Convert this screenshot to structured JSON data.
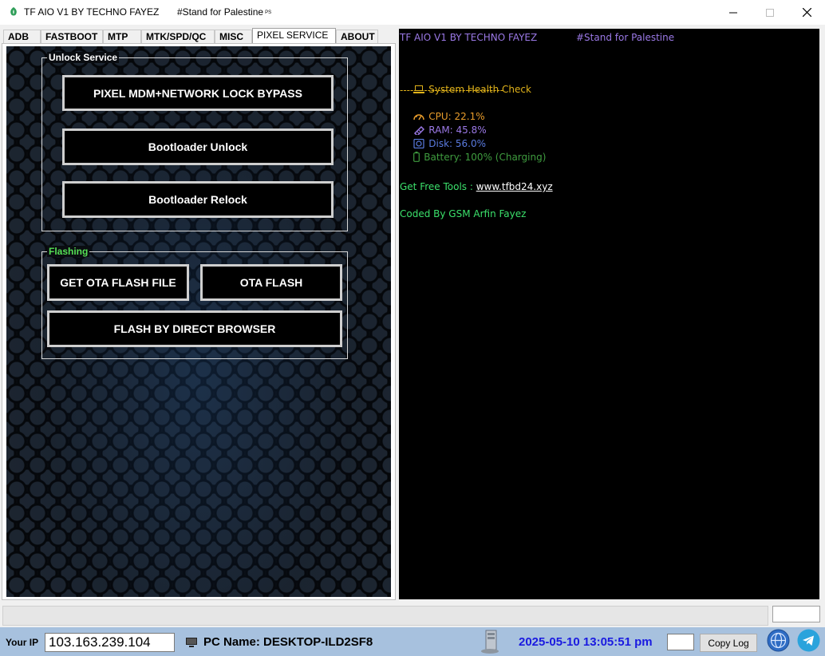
{
  "window": {
    "title": "TF AIO V1 BY TECHNO FAYEZ",
    "subtitle": "#Stand for Palestine",
    "subtitle_suffix": "PS"
  },
  "tabs": [
    {
      "label": "ADB"
    },
    {
      "label": "FASTBOOT"
    },
    {
      "label": "MTP"
    },
    {
      "label": "MTK/SPD/QC"
    },
    {
      "label": "MISC"
    },
    {
      "label": "PIXEL SERVICE",
      "active": true
    },
    {
      "label": "ABOUT"
    }
  ],
  "unlock_service": {
    "legend": "Unlock Service",
    "buttons": {
      "mdm": "PIXEL MDM+NETWORK LOCK BYPASS",
      "bl_unlock": "Bootloader Unlock",
      "bl_relock": "Bootloader Relock"
    }
  },
  "flashing": {
    "legend": "Flashing",
    "buttons": {
      "get_ota": "GET OTA FLASH FILE",
      "ota_flash": "OTA FLASH",
      "direct_browser": "FLASH BY DIRECT BROWSER"
    }
  },
  "log": {
    "header_title": "TF AIO V1 BY TECHNO FAYEZ",
    "header_subtitle": "#Stand for Palestine",
    "health_title": "System Health Check",
    "separator": "------------------------------",
    "cpu": "CPU: 22.1%",
    "ram": "RAM: 45.8%",
    "disk": "Disk: 56.0%",
    "battery": "Battery: 100% (Charging)",
    "tools_label": "Get Free Tools : ",
    "tools_link": "www.tfbd24.xyz",
    "credit": "Coded By GSM Arfin Fayez"
  },
  "bottom": {
    "ip_label": "Your IP",
    "ip_value": "103.163.239.104",
    "pc_name": "PC Name: DESKTOP-ILD2SF8",
    "datetime": "2025-05-10 13:05:51 pm",
    "copy_log": "Copy Log"
  },
  "colors": {
    "log_purple": "#9b79e6",
    "log_gold": "#e0b21a",
    "log_orange": "#e89c2b",
    "log_blue": "#5a7be0",
    "log_battery": "#3f9c3f",
    "log_green": "#3be06b",
    "datetime_blue": "#1a1ae0",
    "bottom_bar": "#a7c1de"
  },
  "icons": [
    "app-icon",
    "minimize-icon",
    "maximize-icon",
    "close-icon",
    "laptop-icon",
    "cpu-icon",
    "ram-icon",
    "disk-icon",
    "battery-icon",
    "pc-icon",
    "server-icon",
    "globe-icon",
    "telegram-icon"
  ]
}
